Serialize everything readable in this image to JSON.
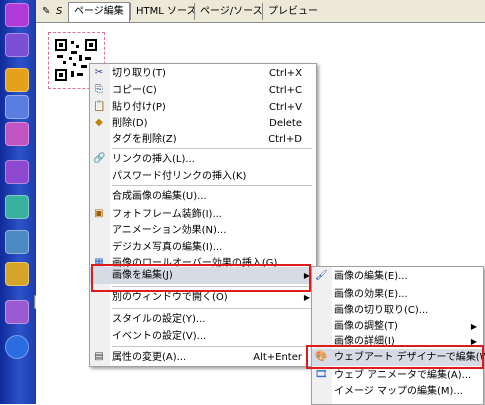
{
  "tabs": [
    {
      "label": "ページ編集",
      "active": true
    },
    {
      "label": "HTML ソース",
      "active": false
    },
    {
      "label": "ページ/ソース",
      "active": false
    },
    {
      "label": "プレビュー",
      "active": false
    }
  ],
  "tab_prefix_icons": [
    "pencil-icon",
    "s-icon"
  ],
  "context_menu": {
    "items": [
      {
        "icon": "scissors-icon",
        "label": "切り取り(T)",
        "shortcut": "Ctrl+X"
      },
      {
        "icon": "copy-icon",
        "label": "コピー(C)",
        "shortcut": "Ctrl+C"
      },
      {
        "icon": "paste-icon",
        "label": "貼り付け(P)",
        "shortcut": "Ctrl+V"
      },
      {
        "icon": "eraser-icon",
        "label": "削除(D)",
        "shortcut": "Delete"
      },
      {
        "icon": "",
        "label": "タグを削除(Z)",
        "shortcut": "Ctrl+D"
      },
      {
        "icon": "link-icon",
        "label": "リンクの挿入(L)...",
        "shortcut": ""
      },
      {
        "icon": "",
        "label": "パスワード付リンクの挿入(K)",
        "shortcut": ""
      },
      {
        "icon": "",
        "label": "合成画像の編集(U)...",
        "shortcut": ""
      },
      {
        "icon": "frame-icon",
        "label": "フォトフレーム装飾(I)...",
        "shortcut": ""
      },
      {
        "icon": "",
        "label": "アニメーション効果(N)...",
        "shortcut": ""
      },
      {
        "icon": "",
        "label": "デジカメ写真の編集(I)...",
        "shortcut": ""
      },
      {
        "icon": "rollover-icon",
        "label": "画像のロールオーバー効果の挿入(G)...",
        "shortcut": ""
      },
      {
        "icon": "",
        "label": "画像を編集(J)",
        "shortcut": "",
        "submenu": true
      },
      {
        "icon": "",
        "label": "別のウィンドウで開く(O)",
        "shortcut": "",
        "submenu": true
      },
      {
        "icon": "",
        "label": "スタイルの設定(Y)...",
        "shortcut": ""
      },
      {
        "icon": "",
        "label": "イベントの設定(V)...",
        "shortcut": ""
      },
      {
        "icon": "properties-icon",
        "label": "属性の変更(A)...",
        "shortcut": "Alt+Enter"
      }
    ]
  },
  "submenu": {
    "items": [
      {
        "icon": "image-edit-icon",
        "label": "画像の編集(E)...",
        "submenu": false
      },
      {
        "icon": "",
        "label": "画像の効果(E)...",
        "submenu": false
      },
      {
        "icon": "",
        "label": "画像の切り取り(C)...",
        "submenu": false
      },
      {
        "icon": "",
        "label": "画像の調整(T)",
        "submenu": true
      },
      {
        "icon": "",
        "label": "画像の詳細(I)",
        "submenu": true
      },
      {
        "icon": "web-art-designer-icon",
        "label": "ウェブアート デザイナーで編集(W)...",
        "submenu": false
      },
      {
        "icon": "web-animator-icon",
        "label": "ウェブ アニメータで編集(A)...",
        "submenu": false
      },
      {
        "icon": "",
        "label": "イメージ マップの編集(M)...",
        "submenu": false
      }
    ]
  },
  "colors": {
    "highlight": "#e01b1b",
    "sidebar": "#1c3bb0"
  }
}
